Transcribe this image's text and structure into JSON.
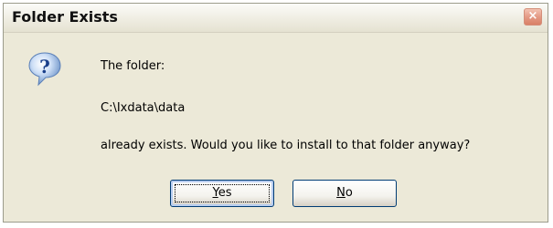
{
  "window": {
    "title": "Folder Exists",
    "close_glyph": "×"
  },
  "icon": {
    "name": "question-icon"
  },
  "message": {
    "line1": "The folder:",
    "path": "C:\\Ixdata\\data",
    "line3": "already exists. Would you like to install to that folder anyway?"
  },
  "buttons": {
    "yes": {
      "accel": "Y",
      "rest": "es"
    },
    "no": {
      "accel": "N",
      "rest": "o"
    }
  },
  "colors": {
    "dialog_bg": "#ece9d8",
    "close_button": "#d98066",
    "button_border": "#003c74"
  }
}
